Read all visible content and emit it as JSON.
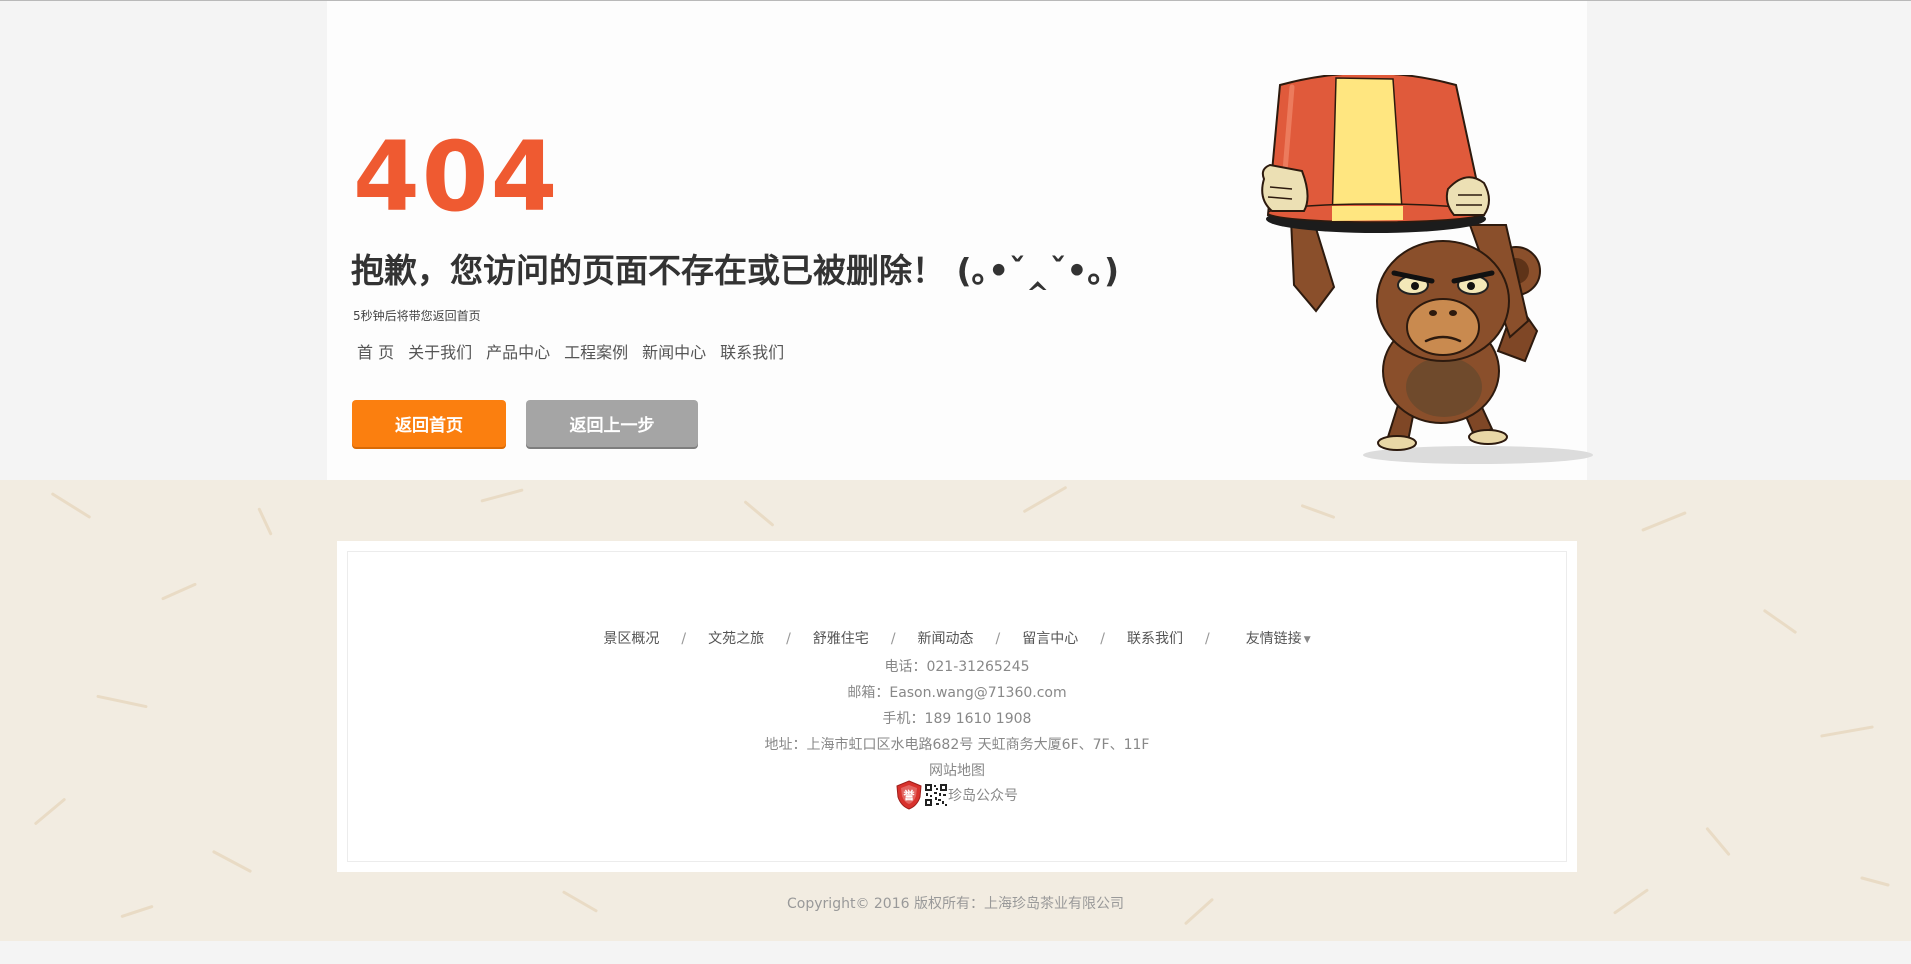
{
  "error": {
    "code": "404",
    "message": "抱歉，您访问的页面不存在或已被删除！ (｡•ˇ‸ˇ•｡)",
    "redirect_note": "5秒钟后将带您返回首页"
  },
  "quick_links": [
    "首 页",
    "关于我们",
    "产品中心",
    "工程案例",
    "新闻中心",
    "联系我们"
  ],
  "buttons": {
    "home": "返回首页",
    "back": "返回上一步"
  },
  "colors": {
    "accent": "#ef5a31",
    "home_button": "#fb7f0f",
    "back_button": "#a5a5a5",
    "footer_background": "#f2ece1"
  },
  "footer": {
    "nav": [
      "景区概况",
      "文苑之旅",
      "舒雅住宅",
      "新闻动态",
      "留言中心",
      "联系我们",
      "友情链接"
    ],
    "separator": "/",
    "phone": "电话：021-31265245",
    "email": "邮箱：Eason.wang@71360.com",
    "mobile": "手机：189 1610 1908",
    "address": "地址：上海市虹口区水电路682号 天虹商务大厦6F、7F、11F",
    "sitemap": "网站地图",
    "badge_char": "誉",
    "wechat_label": "珍岛公众号",
    "copyright": "Copyright© 2016 版权所有：上海珍岛茶业有限公司"
  },
  "icons": [
    "monkey-bucket-illustration",
    "dropdown-caret-icon",
    "credibility-shield-icon",
    "qr-code-icon"
  ]
}
